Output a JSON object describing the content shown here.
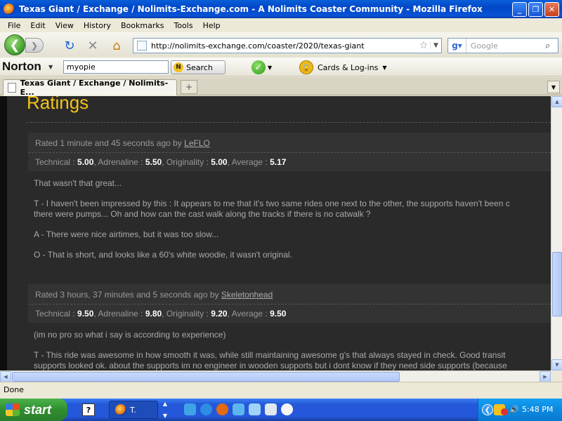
{
  "window": {
    "title": "Texas Giant / Exchange / Nolimits-Exchange.com - A Nolimits Coaster Community - Mozilla Firefox"
  },
  "menu": [
    "File",
    "Edit",
    "View",
    "History",
    "Bookmarks",
    "Tools",
    "Help"
  ],
  "nav": {
    "url": "http://nolimits-exchange.com/coaster/2020/texas-giant",
    "search_placeholder": "Google"
  },
  "norton": {
    "logo": "Norton",
    "input_value": "myopie",
    "search_label": "Search",
    "cards_label": "Cards & Log-ins"
  },
  "tab": {
    "title": "Texas Giant / Exchange / Nolimits-E..."
  },
  "page": {
    "heading": "Ratings",
    "ratings": [
      {
        "rated_prefix": "Rated 1 minute and 45 seconds ago by",
        "author": "LeFLO",
        "technical_label": "Technical :",
        "technical": "5.00",
        "adrenaline_label": ", Adrenaline :",
        "adrenaline": "5.50",
        "originality_label": ", Originality :",
        "originality": "5.00",
        "average_label": ", Average :",
        "average": "5.17",
        "paragraphs": [
          "That wasn't that great...",
          "T - I haven't been impressed by this : It appears to me that it's two same rides one next to the other, the supports haven't been c",
          "there were pumps... Oh and how can the cast walk along the tracks if there is no catwalk ?",
          "A - There were nice airtimes, but it was too slow...",
          "O - That is short, and looks like a 60's white woodie, it wasn't original."
        ]
      },
      {
        "rated_prefix": "Rated 3 hours, 37 minutes and 5 seconds ago by",
        "author": "Skeletonhead",
        "technical_label": "Technical :",
        "technical": "9.50",
        "adrenaline_label": ", Adrenaline :",
        "adrenaline": "9.80",
        "originality_label": ", Originality :",
        "originality": "9.20",
        "average_label": ", Average :",
        "average": "9.50",
        "paragraphs": [
          "(im no pro so what i say is according to experience)",
          "T - This ride was awesome in how smooth it was, while still maintaining awesome g's that always stayed in check. Good transit",
          "supports looked ok. about the supports im no engineer in wooden supports but i dont know if they need side supports (because"
        ]
      }
    ]
  },
  "status": {
    "text": "Done"
  },
  "taskbar": {
    "start_label": "start",
    "task_label": "T.",
    "clock": "5:48 PM"
  }
}
